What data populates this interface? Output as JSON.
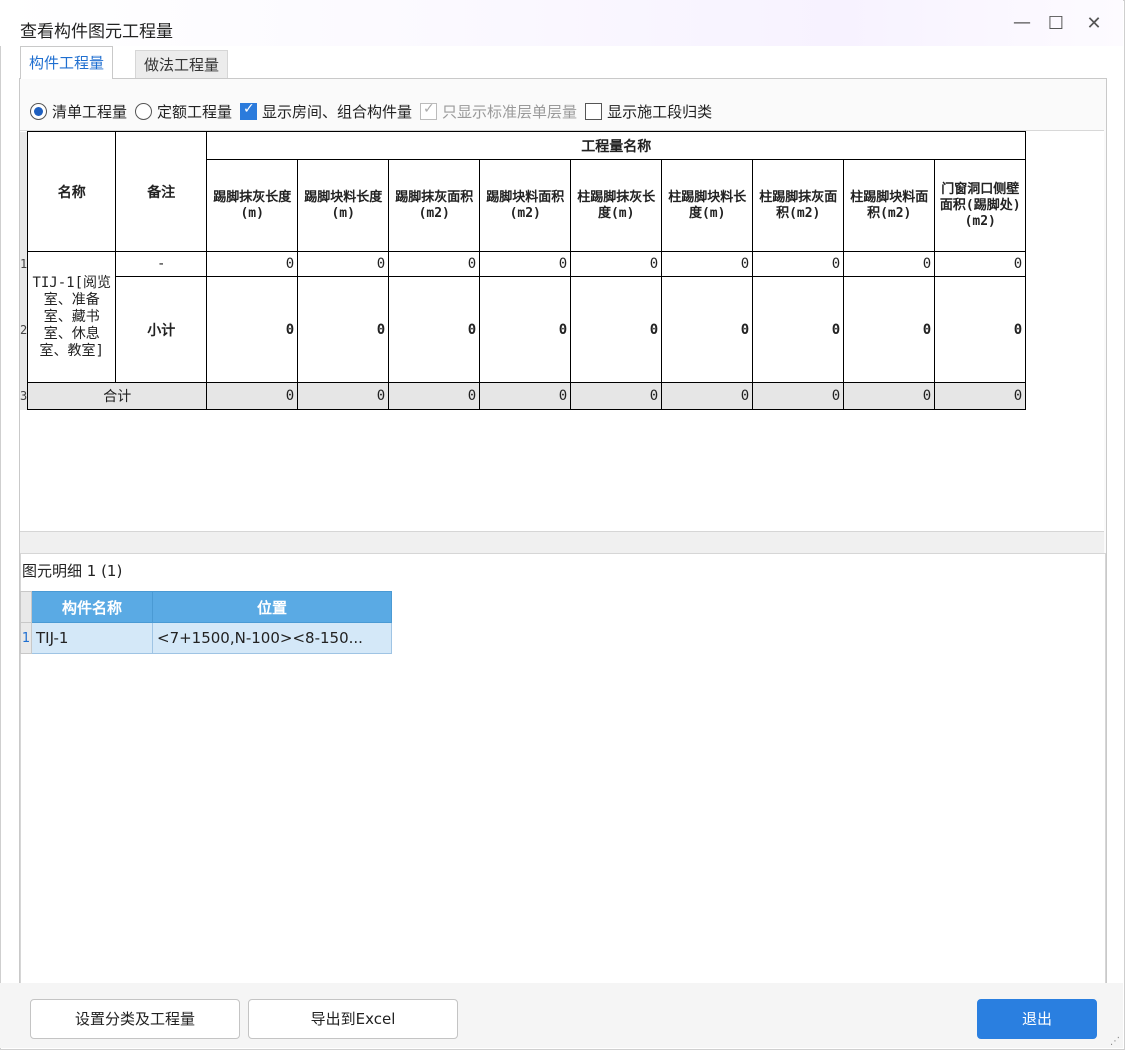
{
  "window": {
    "title": "查看构件图元工程量",
    "controls": [
      "minimize",
      "maximize",
      "close"
    ]
  },
  "tabs": [
    {
      "label": "构件工程量",
      "active": true
    },
    {
      "label": "做法工程量",
      "active": false
    }
  ],
  "options": {
    "list_qty": "清单工程量",
    "quota_qty": "定额工程量",
    "show_room": "显示房间、组合构件量",
    "std_floor_only": "只显示标准层单层量",
    "show_section": "显示施工段归类"
  },
  "qty_table": {
    "col_name": "名称",
    "col_note": "备注",
    "group_header": "工程量名称",
    "columns": [
      "踢脚抹灰长度(m)",
      "踢脚块料长度(m)",
      "踢脚抹灰面积(m2)",
      "踢脚块料面积(m2)",
      "柱踢脚抹灰长度(m)",
      "柱踢脚块料长度(m)",
      "柱踢脚抹灰面积(m2)",
      "柱踢脚块料面积(m2)",
      "门窗洞口侧壁面积(踢脚处)(m2)"
    ],
    "group_name": "TIJ-1[阅览室、准备室、藏书室、休息室、教室]",
    "rows": [
      {
        "num": "1",
        "note": "-",
        "values": [
          "0",
          "0",
          "0",
          "0",
          "0",
          "0",
          "0",
          "0",
          "0"
        ]
      },
      {
        "num": "2",
        "note": "小计",
        "values": [
          "0",
          "0",
          "0",
          "0",
          "0",
          "0",
          "0",
          "0",
          "0"
        ]
      }
    ],
    "total": {
      "num": "3",
      "label": "合计",
      "values": [
        "0",
        "0",
        "0",
        "0",
        "0",
        "0",
        "0",
        "0",
        "0"
      ]
    }
  },
  "detail": {
    "title": "图元明细  1 (1)",
    "columns": [
      "构件名称",
      "位置"
    ],
    "rows": [
      {
        "num": "1",
        "name": "TIJ-1",
        "position": "<7+1500,N-100><8-150..."
      }
    ]
  },
  "buttons": {
    "settings": "设置分类及工程量",
    "export": "导出到Excel",
    "exit": "退出"
  },
  "colors": {
    "accent": "#2a7fe0",
    "header_blue": "#5aaae4",
    "row_selected": "#d4e8f8"
  }
}
